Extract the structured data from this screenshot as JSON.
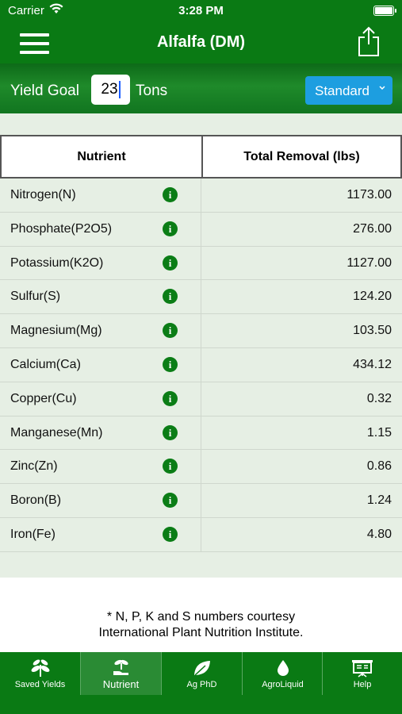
{
  "status_bar": {
    "carrier": "Carrier",
    "time": "3:28 PM"
  },
  "nav": {
    "title": "Alfalfa (DM)"
  },
  "yield": {
    "label": "Yield Goal",
    "value": "23",
    "unit": "Tons",
    "mode": "Standard"
  },
  "table": {
    "headers": {
      "nutrient": "Nutrient",
      "removal": "Total Removal (lbs)"
    },
    "rows": [
      {
        "name": "Nitrogen(N)",
        "value": "1173.00"
      },
      {
        "name": "Phosphate(P2O5)",
        "value": "276.00"
      },
      {
        "name": "Potassium(K2O)",
        "value": "1127.00"
      },
      {
        "name": "Sulfur(S)",
        "value": "124.20"
      },
      {
        "name": "Magnesium(Mg)",
        "value": "103.50"
      },
      {
        "name": "Calcium(Ca)",
        "value": "434.12"
      },
      {
        "name": "Copper(Cu)",
        "value": "0.32"
      },
      {
        "name": "Manganese(Mn)",
        "value": "1.15"
      },
      {
        "name": "Zinc(Zn)",
        "value": "0.86"
      },
      {
        "name": "Boron(B)",
        "value": "1.24"
      },
      {
        "name": "Iron(Fe)",
        "value": "4.80"
      }
    ],
    "info_glyph": "i"
  },
  "footnote": {
    "line1": "* N, P, K and S numbers courtesy",
    "line2": "International Plant Nutrition Institute."
  },
  "tabs": [
    {
      "label": "Saved Yields",
      "icon": "plant-icon",
      "active": false
    },
    {
      "label": "Nutrient",
      "icon": "sprout-hand-icon",
      "active": true
    },
    {
      "label": "Ag PhD",
      "icon": "leaf-icon",
      "active": false
    },
    {
      "label": "AgroLiquid",
      "icon": "droplet-icon",
      "active": false
    },
    {
      "label": "Help",
      "icon": "presentation-icon",
      "active": false
    }
  ],
  "colors": {
    "primary_green": "#0a7a14",
    "table_bg": "#e6efe4",
    "select_blue": "#1d9ee0"
  }
}
